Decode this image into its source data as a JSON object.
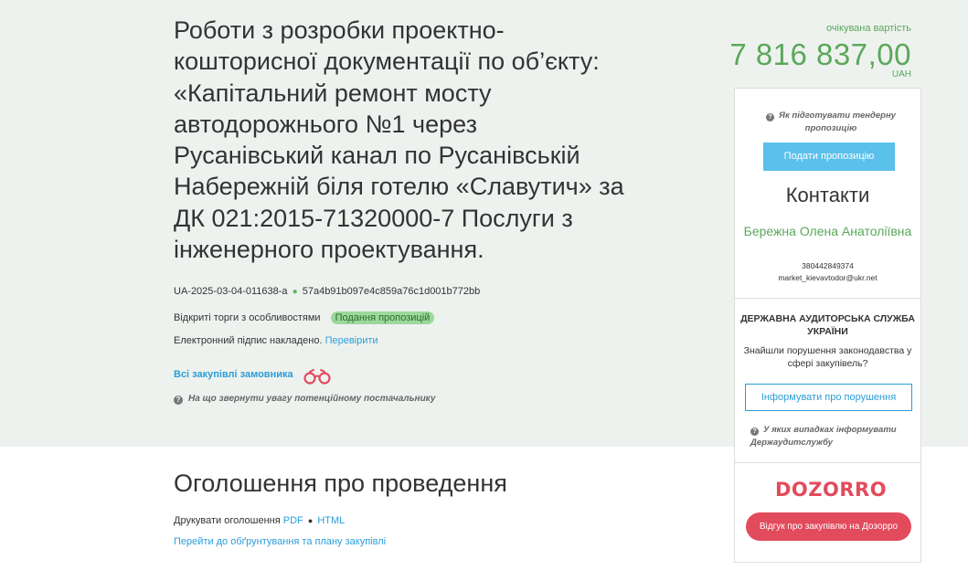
{
  "tender": {
    "title": "Роботи з розробки проектно-кошторисної документації по об’єкту: «Капітальний ремонт мосту автодорожнього №1 через Русанівський канал по Русанівській Набережній біля готелю «Славутич» за ДК 021:2015-71320000-7 Послуги з інженерного проектування.",
    "id": "UA-2025-03-04-011638-a",
    "hash": "57a4b91b097e4c859a76c1d001b772bb",
    "procedure_type": "Відкриті торги з особливостями",
    "status": "Подання пропозицій",
    "esign_text": "Електронний підпис накладено.",
    "esign_link": "Перевірити",
    "all_purchases_link": "Всі закупівлі замовника",
    "attention_text": "На що звернути увагу потенційному постачальнику"
  },
  "value": {
    "caption": "очікувана вартість",
    "amount": "7 816 837,00",
    "currency": "UAH"
  },
  "announcement": {
    "title": "Оголошення про проведення",
    "print_label": "Друкувати оголошення",
    "pdf_link": "PDF",
    "html_link": "HTML",
    "plan_link": "Перейти до обґрунтування та плану закупівлі"
  },
  "sidebar": {
    "howto_text": "Як підготувати тендерну пропозицію",
    "submit_button": "Подати пропозицію",
    "contacts_title": "Контакти",
    "contact_name": "Бережна Олена Анатоліївна",
    "contact_phone": "380442849374",
    "contact_email": "market_kievavtodor@ukr.net",
    "dasu_title": "ДЕРЖАВНА АУДИТОРСЬКА СЛУЖБА УКРАЇНИ",
    "dasu_text": "Знайшли порушення законодавства у сфері закупівель?",
    "report_button": "Інформувати про порушення",
    "when_report_text": "У яких випадках інформувати Держаудитслужбу",
    "dozorro_logo": "DOZORRO",
    "dozorro_button": "Відгук про закупівлю на Дозорро"
  },
  "colors": {
    "accent_green": "#5aa85a",
    "link_blue": "#2a9ed8",
    "button_blue": "#5bc0ea",
    "dozorro_red": "#e24b5c",
    "top_background": "#eef2ef"
  }
}
